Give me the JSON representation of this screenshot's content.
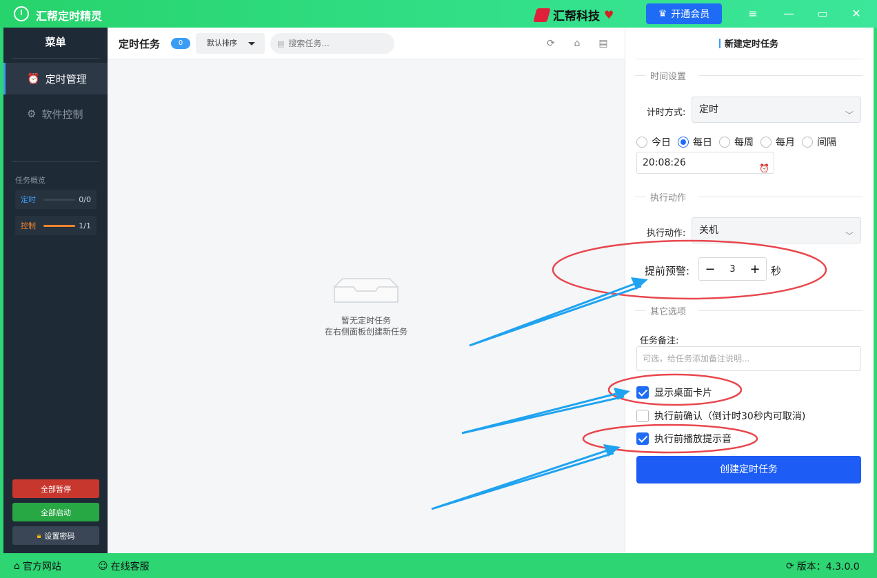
{
  "app": {
    "title": "汇帮定时精灵",
    "brand": "汇帮科技",
    "vip_label": "开通会员"
  },
  "sidebar": {
    "menu_title": "菜单",
    "items": [
      {
        "label": "定时管理",
        "icon": "alarm-clock-icon",
        "active": true
      },
      {
        "label": "软件控制",
        "icon": "gear-icon",
        "active": false
      }
    ],
    "overview_label": "任务概览",
    "overview": [
      {
        "name": "定时",
        "count": "0/0",
        "progress": 0,
        "color": "#3b9cf5"
      },
      {
        "name": "控制",
        "count": "1/1",
        "progress": 1,
        "color": "#f0842c"
      }
    ],
    "buttons": {
      "pause_all": "全部暂停",
      "start_all": "全部启动",
      "set_password": "设置密码"
    }
  },
  "main": {
    "title": "定时任务",
    "count": "0",
    "sort_label": "默认排序",
    "search_placeholder": "搜索任务...",
    "empty_line1": "暂无定时任务",
    "empty_line2": "在右侧面板创建新任务"
  },
  "panel": {
    "title": "新建定时任务",
    "section_time": "时间设置",
    "timing_label": "计时方式:",
    "timing_value": "定时",
    "radios": [
      {
        "label": "今日",
        "checked": false
      },
      {
        "label": "每日",
        "checked": true
      },
      {
        "label": "每周",
        "checked": false
      },
      {
        "label": "每月",
        "checked": false
      },
      {
        "label": "间隔",
        "checked": false
      }
    ],
    "time_value": "20:08:26",
    "section_action": "执行动作",
    "action_label": "执行动作:",
    "action_value": "关机",
    "warn_label": "提前预警:",
    "warn_value": "3",
    "warn_unit": "秒",
    "section_other": "其它选项",
    "note_label": "任务备注:",
    "note_placeholder": "可选，给任务添加备注说明...",
    "checks": [
      {
        "label": "显示桌面卡片",
        "checked": true
      },
      {
        "label": "执行前确认（倒计时30秒内可取消)",
        "checked": false
      },
      {
        "label": "执行前播放提示音",
        "checked": true
      }
    ],
    "create_label": "创建定时任务"
  },
  "statusbar": {
    "website": "官方网站",
    "support": "在线客服",
    "version": "版本：4.3.0.0"
  },
  "colors": {
    "green": "#2ed573",
    "accent": "#1e6cf5",
    "annotation_red": "#e8474d",
    "annotation_blue": "#1fa3f0"
  }
}
